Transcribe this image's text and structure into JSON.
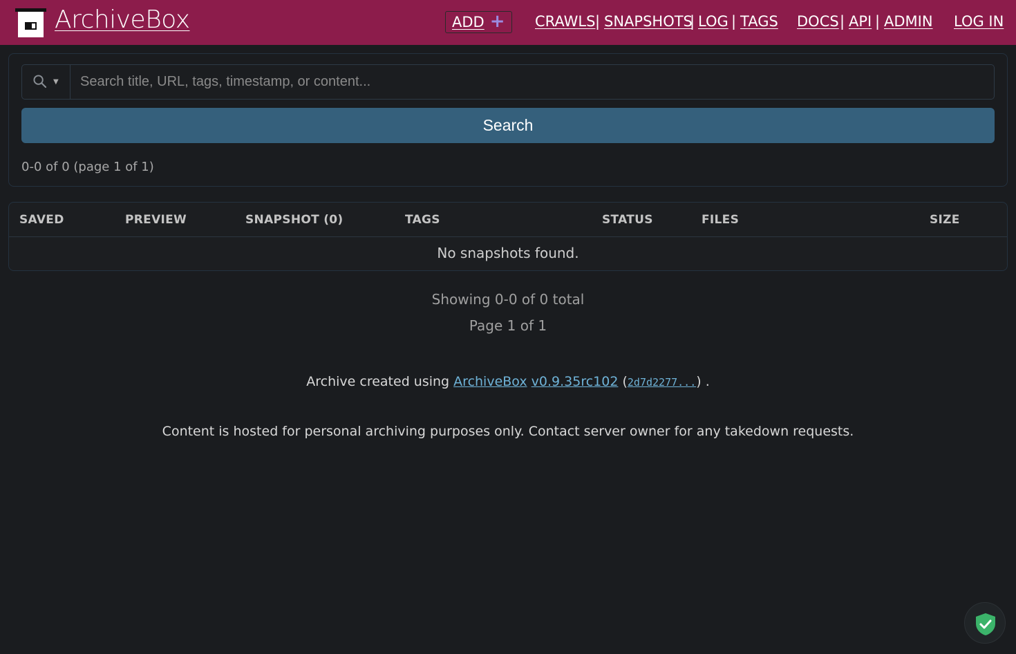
{
  "header": {
    "logo_text": "ArchiveBox",
    "add_label": "ADD",
    "nav": {
      "crawls": "CRAWLS",
      "snapshots": "SNAPSHOTS",
      "log": "LOG",
      "tags": "TAGS",
      "docs": "DOCS",
      "api": "API",
      "admin": "ADMIN",
      "login": "LOG IN"
    },
    "separator": "|"
  },
  "search": {
    "placeholder": "Search title, URL, tags, timestamp, or content...",
    "value": "",
    "button_label": "Search",
    "result_count": "0-0 of 0 (page 1 of 1)"
  },
  "table": {
    "columns": [
      "SAVED",
      "PREVIEW",
      "SNAPSHOT (0)",
      "TAGS",
      "STATUS",
      "FILES",
      "SIZE"
    ],
    "empty_message": "No snapshots found."
  },
  "pagination": {
    "showing": "Showing 0-0 of 0 total",
    "page": "Page 1 of 1"
  },
  "footer": {
    "credit_prefix": "Archive created using",
    "credit_app": "ArchiveBox",
    "credit_version": "v0.9.35rc102",
    "credit_hash": "2d7d2277...",
    "credit_suffix": ".",
    "disclaimer": "Content is hosted for personal archiving purposes only. Contact server owner for any takedown requests."
  },
  "colors": {
    "header_bg": "#8c1c4b",
    "page_bg": "#1a1c1f",
    "button_bg": "#35607c",
    "link": "#6fb3d8",
    "shield": "#3bb36a"
  },
  "icons": {
    "search": "search-icon",
    "add": "plus-icon",
    "shield": "shield-check-icon"
  }
}
